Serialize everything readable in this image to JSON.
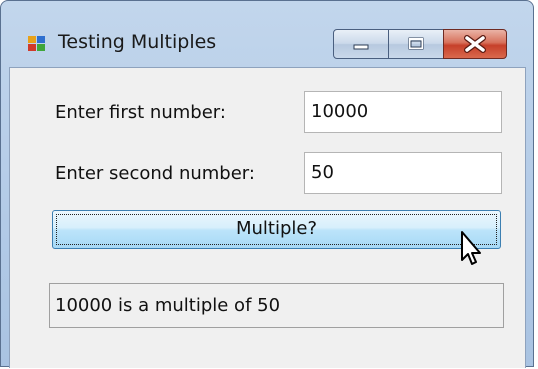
{
  "window": {
    "title": "Testing Multiples",
    "icon": "windows-forms-app-icon",
    "caption_buttons": [
      "minimize",
      "maximize",
      "close"
    ]
  },
  "form": {
    "first_label": "Enter first number:",
    "first_value": "10000",
    "second_label": "Enter second number:",
    "second_value": "50",
    "button_label": "Multiple?",
    "result_text": "10000 is a multiple of 50"
  },
  "colors": {
    "close_button": "#c6402a",
    "button_accent": "#a7d9f5",
    "client_background": "#f0f0f0"
  }
}
